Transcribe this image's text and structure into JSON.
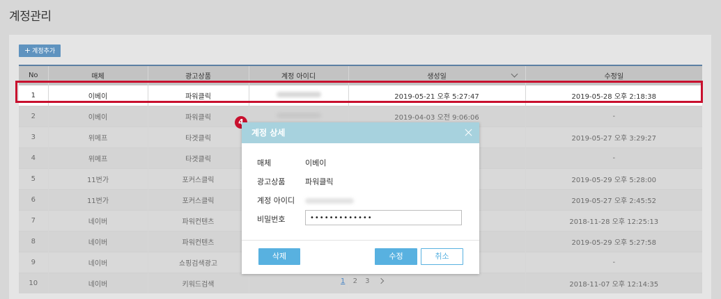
{
  "page_title": "계정관리",
  "toolbar": {
    "add_label": "계정추가"
  },
  "table": {
    "headers": [
      "No",
      "매체",
      "광고상품",
      "계정 아이디",
      "생성일",
      "수정일"
    ],
    "rows": [
      {
        "no": "1",
        "media": "이베이",
        "product": "파워클릭",
        "created": "2019-05-21 오후 5:27:47",
        "modified": "2019-05-28 오후 2:18:38"
      },
      {
        "no": "2",
        "media": "이베이",
        "product": "파워클릭",
        "created": "2019-04-03 오전 9:06:06",
        "modified": "-"
      },
      {
        "no": "3",
        "media": "위메프",
        "product": "타겟클릭",
        "created": "",
        "modified": "2019-05-27 오후 3:29:27"
      },
      {
        "no": "4",
        "media": "위메프",
        "product": "타겟클릭",
        "created": "",
        "modified": "-"
      },
      {
        "no": "5",
        "media": "11번가",
        "product": "포커스클릭",
        "created": "",
        "modified": "2019-05-29 오후 5:28:00"
      },
      {
        "no": "6",
        "media": "11번가",
        "product": "포커스클릭",
        "created": "",
        "modified": "2019-05-27 오후 2:45:52"
      },
      {
        "no": "7",
        "media": "네이버",
        "product": "파워컨텐츠",
        "created": "",
        "modified": "2018-11-28 오후 12:25:13"
      },
      {
        "no": "8",
        "media": "네이버",
        "product": "파워컨텐츠",
        "created": "",
        "modified": "2019-05-29 오후 5:27:58"
      },
      {
        "no": "9",
        "media": "네이버",
        "product": "쇼핑검색광고",
        "created": "",
        "modified": "-"
      },
      {
        "no": "10",
        "media": "네이버",
        "product": "키워드검색",
        "created": "",
        "modified": "2018-11-07 오후 12:14:35"
      }
    ]
  },
  "step_badge": "4",
  "modal": {
    "title": "계정 상세",
    "fields": {
      "media_label": "매체",
      "media_value": "이베이",
      "product_label": "광고상품",
      "product_value": "파워클릭",
      "account_label": "계정 아이디",
      "password_label": "비밀번호",
      "password_value": "•••••••••••••"
    },
    "delete_label": "삭제",
    "edit_label": "수정",
    "cancel_label": "취소"
  },
  "pagination": {
    "pages": [
      "1",
      "2",
      "3"
    ],
    "current": "1"
  },
  "colors": {
    "highlight": "#c8102e",
    "modal_header": "#a7d2de",
    "primary": "#58b1e0",
    "table_header_border": "#5b7fa3"
  }
}
